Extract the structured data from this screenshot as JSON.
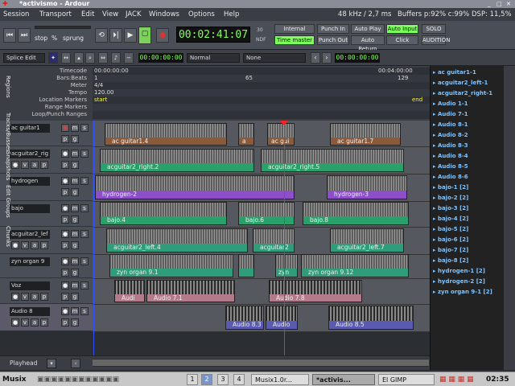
{
  "window": {
    "title": "*activismo - Ardour"
  },
  "menu": [
    "Session",
    "Transport",
    "Edit",
    "View",
    "JACK",
    "Windows",
    "Options",
    "Help"
  ],
  "status": {
    "sample_rate": "48 kHz / 2,7 ms",
    "buffers": "Buffers p:92% c:99%",
    "dsp": "DSP: 11,5%"
  },
  "transport": {
    "stop_label": "stop",
    "pct_label": "%",
    "sprung_label": "sprung",
    "clock": "00:02:41:07",
    "fps_top": "30",
    "fps_bottom": "NDF",
    "internal": "Internal",
    "time_master": "Time master",
    "punch_in": "Punch In",
    "punch_out": "Punch Out",
    "auto_play": "Auto Play",
    "auto_return": "Auto Return",
    "auto_input": "Auto Input",
    "click": "Click",
    "solo": "SOLO",
    "audition": "AUDITION"
  },
  "toolbar": {
    "edit_mode": "Splice Edit",
    "clock1": "00:00:00:00",
    "snap_type": "Normal",
    "snap_mode": "None",
    "clock2": "00:00:00:00"
  },
  "rulers": {
    "labels": [
      "Timecode",
      "Bars:Beats",
      "Meter",
      "Tempo",
      "Location Markers",
      "Range Markers",
      "Loop/Punch Ranges"
    ],
    "timecode_start": "00:00:00:00",
    "timecode_end": "00:04:00:00",
    "bars": [
      "1",
      "65",
      "129"
    ],
    "meter": "4/4",
    "tempo": "120.00",
    "loc_start": "start",
    "loc_end": "end"
  },
  "tracks": [
    {
      "name": "ac guitar1"
    },
    {
      "name": "acguitar2_rig"
    },
    {
      "name": "hydrogen"
    },
    {
      "name": "bajo"
    },
    {
      "name": "acguitar2_lef"
    },
    {
      "name": "zyn organ 9"
    },
    {
      "name": "Voz"
    },
    {
      "name": "Audio 8"
    }
  ],
  "track_buttons": {
    "rec": "●",
    "mute": "m",
    "solo": "s",
    "automation": "a",
    "playlist": "p",
    "group": "g",
    "v": "v",
    "a2": "a"
  },
  "regions": {
    "r0a": "ac guitar1.4",
    "r0b": "a",
    "r0c": "ac gui",
    "r0d": "ac guitar1.7",
    "r1a": "acguitar2_right.2",
    "r1b": "acguitar2_right.5",
    "r2a": "hydrogen-2",
    "r2b": "hydrogen-3",
    "r3a": "bajo.4",
    "r3b": "bajo.6",
    "r3c": "bajo.8",
    "r4a": "acguitar2_left.4",
    "r4b": "acguitar2",
    "r4c": "acguitar2_left.7",
    "r5a": "zyn organ 9.1",
    "r5b": "zyn",
    "r5c": "zyn organ 9.12",
    "r6a": "Audi",
    "r6b": "Audio 7.1",
    "r6c": "Audio 7.8",
    "r7a": "Audio 8.3",
    "r7b": "Audio",
    "r7c": "Audio 8.5"
  },
  "playhead_label": "Playhead",
  "region_list": [
    "ac guitar1-1",
    "acguitar2_left-1",
    "acguitar2_right-1",
    "Audio 1-1",
    "Audio 7-1",
    "Audio 8-1",
    "Audio 8-2",
    "Audio 8-3",
    "Audio 8-4",
    "Audio 8-5",
    "Audio 8-6",
    "bajo-1 [2]",
    "bajo-2 [2]",
    "bajo-3 [2]",
    "bajo-4 [2]",
    "bajo-5 [2]",
    "bajo-6 [2]",
    "bajo-7 [2]",
    "bajo-8 [2]",
    "hydrogen-1 [2]",
    "hydrogen-2 [2]",
    "zyn organ 9-1 [2]"
  ],
  "side_tabs": [
    "Regions",
    "Tracks/Busses",
    "Snapshots",
    "Edit Groups",
    "Chunks"
  ],
  "taskbar": {
    "start": "Musix",
    "desks": [
      "1",
      "2",
      "3",
      "4"
    ],
    "apps": [
      "Musix1.0r...",
      "*activis...",
      "El GIMP"
    ],
    "clock": "02:35"
  },
  "colors": {
    "brown": "#8a5a3a",
    "green": "#2aa06a",
    "purple": "#8d4fc9",
    "teal": "#2f9d7a",
    "pink": "#b37a8a",
    "blue": "#5a5ab0",
    "lightgreen": "#7cff5a"
  }
}
